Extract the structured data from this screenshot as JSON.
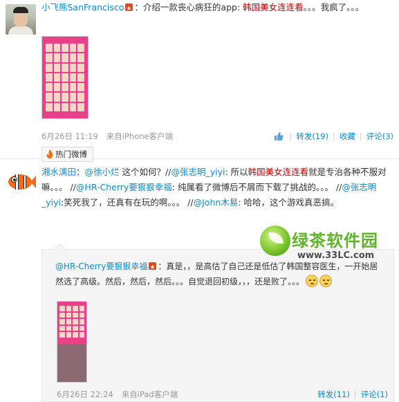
{
  "post1": {
    "author": "小飞熊SanFrancisco",
    "text_before": "：介绍一款丧心病狂的app: ",
    "app_name": "韩国美女连连看",
    "text_after": "。。。我疯了。。。",
    "timestamp": "6月26日 11:19",
    "source_prefix": "来自",
    "source": "iPhone客户端",
    "repost_label": "转发(19)",
    "favorite_label": "收藏",
    "comment_label": "评论(3)",
    "hot_label": "热门微博"
  },
  "post2": {
    "author": "湘水漓田",
    "seg1": "：",
    "mention1": "@徐小烂",
    "seg2": " 这个如何？//",
    "mention2": "@张志明_yiyi",
    "seg3": ": 所以",
    "app_name": "韩国美女连连看",
    "seg4": "就是专治各种不服对嘛。。。 //",
    "mention3": "@HR-Cherry要狠狠幸福",
    "seg5": ": 纯属看了微博后不屑而下载了挑战的。。。 //",
    "mention4": "@张志明_yiyi",
    "seg6": ":笑死我了，还真有在玩的啊。。。 //",
    "mention5": "@John木易",
    "seg7": ": 哈哈，这个游戏真恶搞。"
  },
  "quoted": {
    "author": "@HR-Cherry要狠狠幸福",
    "text": "：真是，，是高估了自己还是低估了韩国整容医生，一开始居然选了高级。然后，然后，然后。。。自觉退回初级，，，还是败了。。。",
    "timestamp": "6月26日 22:24",
    "source_prefix": "来自",
    "source": "iPad客户端",
    "repost_label": "转发(11)",
    "comment_label": "评论(1)"
  },
  "watermark": {
    "title": "绿茶软件园",
    "url": "www.33LC.com"
  },
  "colors": {
    "link": "#0a8cd2",
    "app_link": "#c10000",
    "thumb_bg": "#e8418a"
  }
}
